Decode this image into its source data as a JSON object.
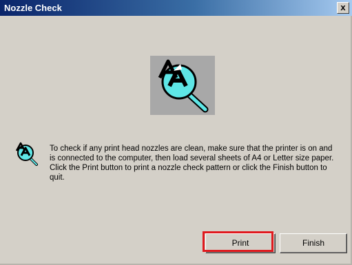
{
  "window": {
    "title": "Nozzle Check",
    "close_label": "x"
  },
  "icons": {
    "large": "nozzle-check-magnifier-icon",
    "small": "nozzle-check-magnifier-icon"
  },
  "message": "To check if any print head nozzles are clean, make sure that the printer is on and is connected to the computer, then load several sheets of A4 or Letter size paper. Click the Print button to print a nozzle check pattern or click the Finish button to quit.",
  "buttons": {
    "print_label": "Print",
    "finish_label": "Finish"
  },
  "colors": {
    "dialog_background": "#d4d0c8",
    "title_bar_start": "#0a246a",
    "title_bar_end": "#a6caf0",
    "highlight": "#e0191e",
    "icon_cyan": "#5ee6e6"
  }
}
